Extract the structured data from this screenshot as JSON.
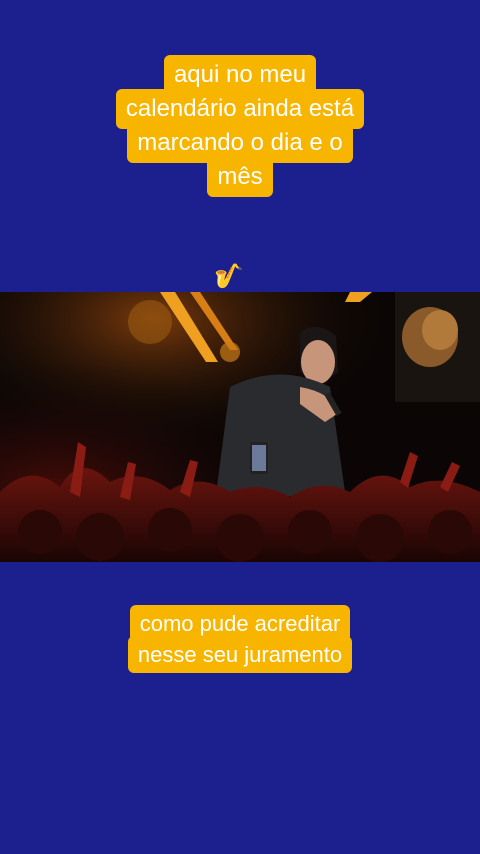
{
  "top_caption": {
    "lines": [
      "aqui no meu",
      "calendário ainda está",
      "marcando o dia e o",
      "mês"
    ]
  },
  "emoji": {
    "glyph": "🎷",
    "icon": "saxophone-icon"
  },
  "video": {
    "description_icon": "concert-video-frame"
  },
  "bottom_caption": {
    "lines": [
      "como pude acreditar",
      "nesse seu juramento"
    ]
  },
  "colors": {
    "background": "#1c1f8e",
    "caption_box": "#f7b500",
    "caption_text": "#ffffff"
  }
}
